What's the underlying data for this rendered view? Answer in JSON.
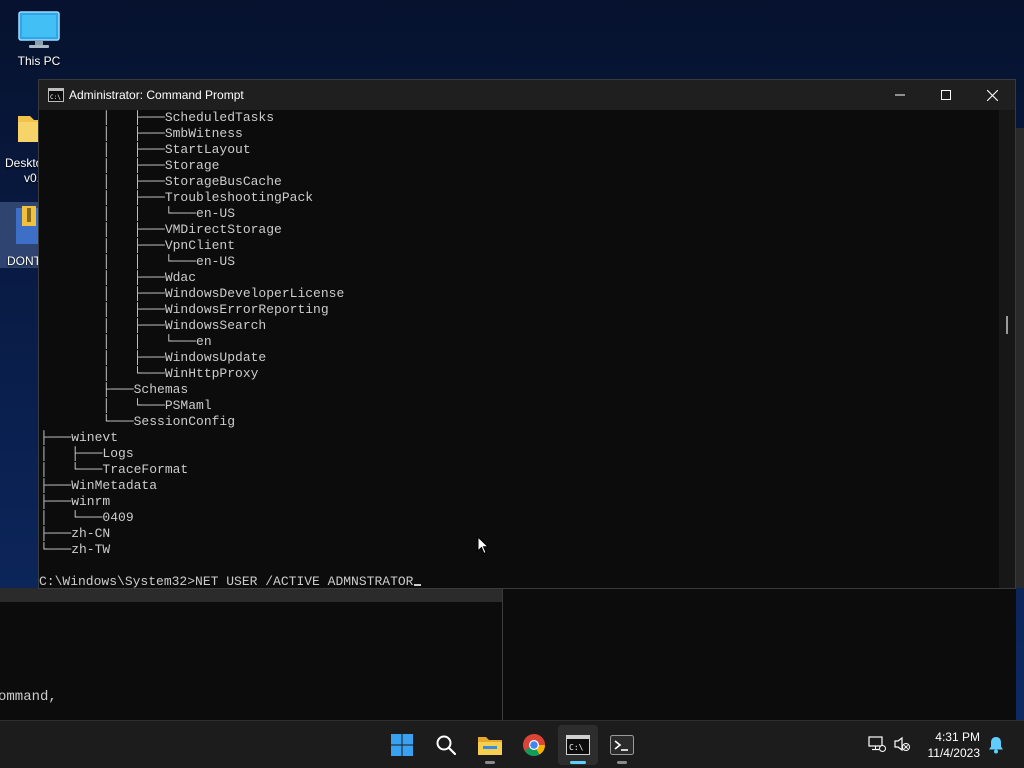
{
  "desktop": {
    "icons": [
      {
        "label": "This PC"
      },
      {
        "label": "Deskto"
      },
      {
        "label": "v0."
      },
      {
        "label": "DONT"
      }
    ]
  },
  "window": {
    "title": "Administrator: Command Prompt",
    "buttons": {
      "minimize": "minimize-icon",
      "maximize": "maximize-icon",
      "close": "close-icon"
    }
  },
  "console": {
    "lines": [
      "        │   ├───ScheduledTasks",
      "        │   ├───SmbWitness",
      "        │   ├───StartLayout",
      "        │   ├───Storage",
      "        │   ├───StorageBusCache",
      "        │   ├───TroubleshootingPack",
      "        │   │   └───en-US",
      "        │   ├───VMDirectStorage",
      "        │   ├───VpnClient",
      "        │   │   └───en-US",
      "        │   ├───Wdac",
      "        │   ├───WindowsDeveloperLicense",
      "        │   ├───WindowsErrorReporting",
      "        │   ├───WindowsSearch",
      "        │   │   └───en",
      "        │   ├───WindowsUpdate",
      "        │   └───WinHttpProxy",
      "        ├───Schemas",
      "        │   └───PSMaml",
      "        └───SessionConfig",
      "├───winevt",
      "│   ├───Logs",
      "│   └───TraceFormat",
      "├───WinMetadata",
      "├───winrm",
      "│   └───0409",
      "├───zh-CN",
      "└───zh-TW"
    ],
    "prompt": "C:\\Windows\\System32>",
    "command": "NET USER /ACTIVE ADMNSTRATOR"
  },
  "back_window": {
    "text": "ommand,"
  },
  "taskbar": {
    "items": [
      {
        "name": "start-button",
        "icon": "windows-logo-icon"
      },
      {
        "name": "search-button",
        "icon": "search-icon"
      },
      {
        "name": "file-explorer-button",
        "icon": "folder-icon"
      },
      {
        "name": "chrome-button",
        "icon": "chrome-icon"
      },
      {
        "name": "command-prompt-button",
        "icon": "cmd-icon"
      },
      {
        "name": "terminal-button",
        "icon": "terminal-icon"
      }
    ],
    "time": "4:31 PM",
    "date": "11/4/2023"
  }
}
